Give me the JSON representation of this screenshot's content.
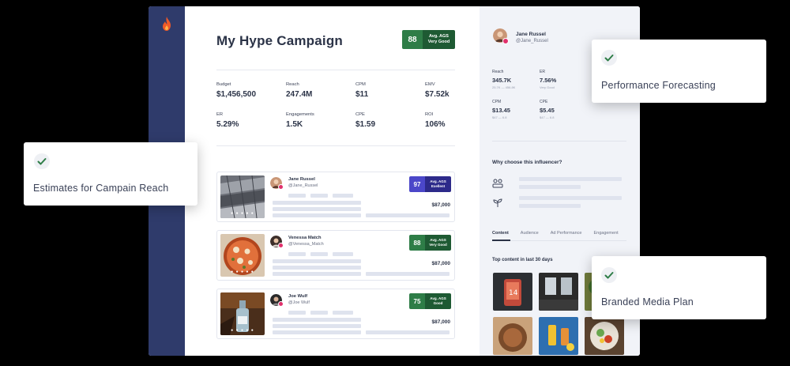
{
  "colors": {
    "rail": "#2f3b6b",
    "accent_green": "#2e7d47",
    "accent_purple": "#4b47c9",
    "flame": "#f05a28"
  },
  "icons": {
    "logo": "flame-icon",
    "check": "check-icon",
    "instagram": "instagram-icon"
  },
  "campaign": {
    "title": "My Hype Campaign",
    "ags": {
      "score": "88",
      "line1": "Avg. AGS",
      "line2": "Very Good"
    },
    "metrics": [
      {
        "label": "Budget",
        "value": "$1,456,500"
      },
      {
        "label": "Reach",
        "value": "247.4M"
      },
      {
        "label": "CPM",
        "value": "$11"
      },
      {
        "label": "EMV",
        "value": "$7.52k"
      },
      {
        "label": "ER",
        "value": "5.29%"
      },
      {
        "label": "Engagements",
        "value": "1.5K"
      },
      {
        "label": "CPE",
        "value": "$1.59"
      },
      {
        "label": "ROI",
        "value": "106%"
      }
    ]
  },
  "influencers": [
    {
      "name": "Jane Russel",
      "handle": "@Jane_Russel",
      "score": "97",
      "ags_line1": "Avg. AGS",
      "ags_line2": "Exellent",
      "price": "$87,000",
      "dots": "● ● ● ● ●",
      "badge_color": "#4b47c9"
    },
    {
      "name": "Venessa Match",
      "handle": "@Venessa_Match",
      "score": "88",
      "ags_line1": "Avg. AGS",
      "ags_line2": "Very Good",
      "price": "$87,000",
      "dots": "● ● ● ● ●",
      "badge_color": "#2e7d47"
    },
    {
      "name": "Joe Wulf",
      "handle": "@Joe Wulf",
      "score": "75",
      "ags_line1": "Avg. AGS",
      "ags_line2": "Good",
      "price": "$87,000",
      "dots": "● ● ● ● ●",
      "badge_color": "#2e7d47"
    }
  ],
  "profile": {
    "name": "Jane Russel",
    "handle": "@Jane_Russel",
    "stats": [
      {
        "label": "Reach",
        "value": "345.7K",
        "sub": "25.7K — 456.8K"
      },
      {
        "label": "ER",
        "value": "7.56%",
        "sub": "Very Good"
      },
      {
        "label": "CPM",
        "value": "$13.45",
        "sub": "$47 — 6.8"
      },
      {
        "label": "CPE",
        "value": "$5.45",
        "sub": "$47 — 6.8"
      }
    ],
    "why_title": "Why choose this influencer?",
    "tabs": [
      "Content",
      "Audience",
      "Ad Performance",
      "Engagement"
    ],
    "top_content_title": "Top content in last 30 days"
  },
  "features": [
    {
      "label": "Performance Forecasting"
    },
    {
      "label": "Estimates for Campain Reach"
    },
    {
      "label": "Branded Media Plan"
    }
  ]
}
